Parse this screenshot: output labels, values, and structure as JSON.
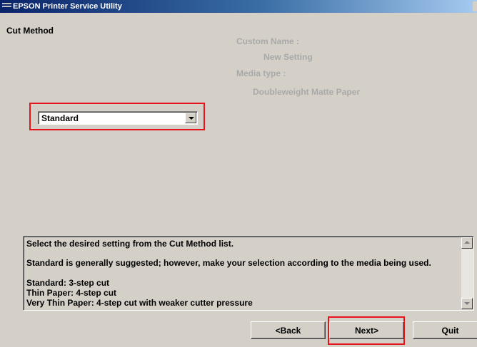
{
  "window": {
    "title": "EPSON Printer Service Utility"
  },
  "page": {
    "section_title": "Cut Method"
  },
  "info": {
    "custom_name_label": "Custom Name :",
    "custom_name_value": "New Setting",
    "media_type_label": "Media type :",
    "media_type_value": "Doubleweight Matte Paper"
  },
  "cut_method_select": {
    "selected": "Standard"
  },
  "description": {
    "lines": [
      "Select the desired setting from the Cut Method list.",
      "Standard is generally suggested; however, make your selection according to the media being used.",
      "Standard: 3-step cut",
      "Thin Paper: 4-step cut",
      "Very Thin Paper: 4-step cut with weaker cutter pressure"
    ]
  },
  "buttons": {
    "back": "<Back",
    "next": "Next>",
    "quit": "Quit"
  },
  "colors": {
    "highlight": "#e8141c",
    "info_text": "#a9a9a9",
    "dialog_background": "#d4d0c8",
    "titlebar": "#0a246a"
  },
  "icons": {
    "app": "printer-icon",
    "dropdown": "chevron-down-icon",
    "scroll_up": "scroll-up-icon",
    "scroll_down": "scroll-down-icon"
  }
}
